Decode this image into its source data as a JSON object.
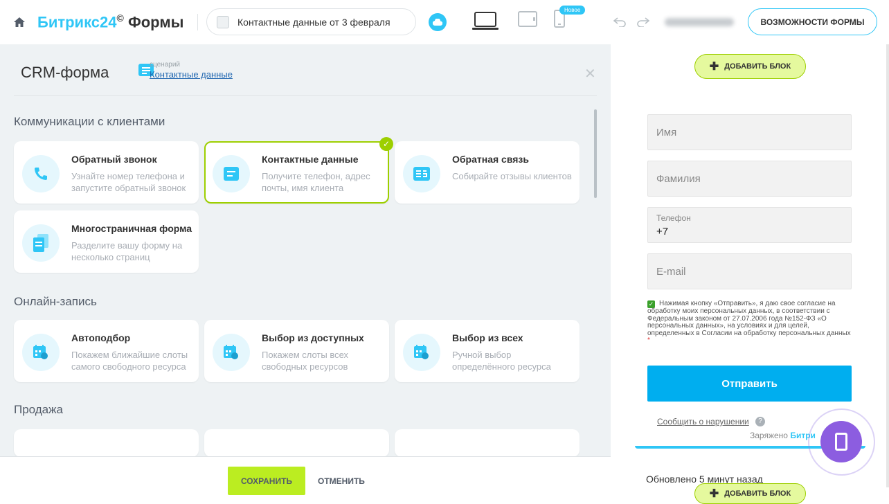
{
  "header": {
    "brand_main": "Битрикс24",
    "brand_mark": "©",
    "brand_sub": "Формы",
    "form_name": "Контактные данные от 3 февраля",
    "new_badge": "Новое",
    "features_button": "ВОЗМОЖНОСТИ ФОРМЫ"
  },
  "panel": {
    "title": "CRM-форма",
    "scenario_label": "сценарий",
    "scenario_value": "Контактные данные",
    "sections": {
      "communications": "Коммуникации с клиентами",
      "booking": "Онлайн-запись",
      "sales": "Продажа"
    },
    "cards": [
      {
        "title": "Обратный звонок",
        "desc": "Узнайте номер телефона и запустите обратный звонок"
      },
      {
        "title": "Контактные данные",
        "desc": "Получите телефон, адрес почты, имя клиента"
      },
      {
        "title": "Обратная связь",
        "desc": "Собирайте отзывы клиентов"
      },
      {
        "title": "Многостраничная форма",
        "desc": "Разделите вашу форму на несколько страниц"
      },
      {
        "title": "Автоподбор",
        "desc": "Покажем ближайшие слоты самого свободного ресурса"
      },
      {
        "title": "Выбор из доступных",
        "desc": "Покажем слоты всех свободных ресурсов"
      },
      {
        "title": "Выбор из всех",
        "desc": "Ручной выбор определённого ресурса"
      }
    ],
    "save_button": "СОХРАНИТЬ",
    "cancel_button": "ОТМЕНИТЬ"
  },
  "preview": {
    "add_block": "ДОБАВИТЬ БЛОК",
    "fields": {
      "name": "Имя",
      "surname": "Фамилия",
      "phone_label": "Телефон",
      "phone_value": "+7",
      "email": "E-mail"
    },
    "consent": "Нажимая кнопку «Отправить», я даю свое согласие на обработку моих персональных данных, в соответствии с Федеральным законом от 27.07.2006 года №152-ФЗ «О персональных данных», на условиях и для целей, определенных в Согласии на обработку персональных данных",
    "consent_star": "*",
    "submit": "Отправить",
    "report": "Сообщить о нарушении",
    "powered_prefix": "Заряжено",
    "powered_brand": "Битри",
    "updated": "Обновлено 5 минут назад"
  }
}
